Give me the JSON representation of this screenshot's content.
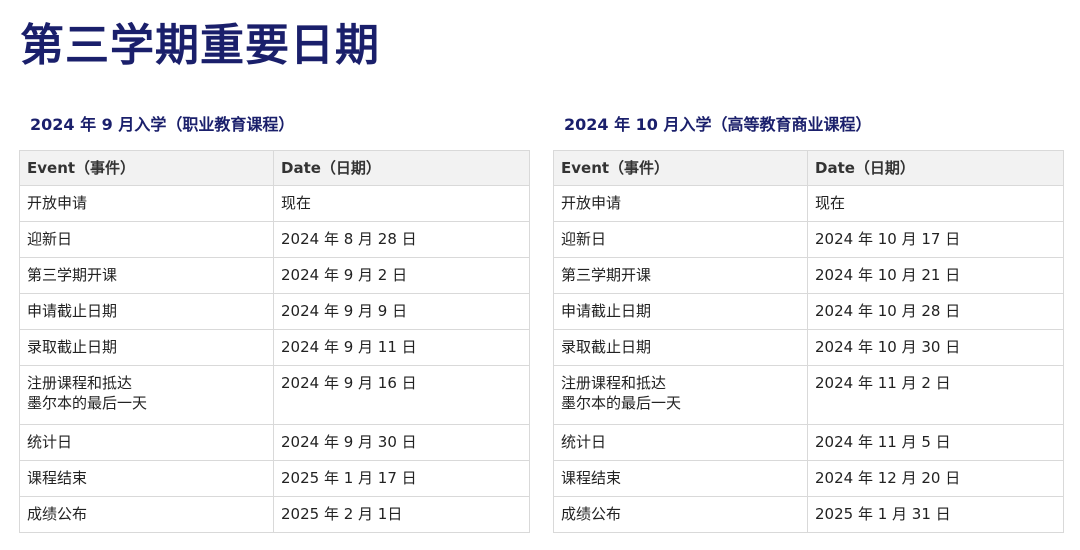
{
  "page": {
    "title": "第三学期重要日期"
  },
  "sections": [
    {
      "heading": "2024 年 9 月入学（职业教育课程）",
      "columns": [
        "Event（事件）",
        "Date（日期）"
      ],
      "rows": [
        {
          "event": "开放申请",
          "date": "现在"
        },
        {
          "event": "迎新日",
          "date": "2024 年 8 月 28 日"
        },
        {
          "event": "第三学期开课",
          "date": "2024 年 9 月 2 日"
        },
        {
          "event": "申请截止日期",
          "date": "2024 年 9 月 9 日"
        },
        {
          "event": "录取截止日期",
          "date": "2024 年 9 月 11 日"
        },
        {
          "event": "注册课程和抵达\n墨尔本的最后一天",
          "date": "2024 年 9 月 16 日"
        },
        {
          "event": "统计日",
          "date": "2024 年 9 月 30 日"
        },
        {
          "event": "课程结束",
          "date": "2025 年 1 月 17 日"
        },
        {
          "event": "成绩公布",
          "date": "2025 年 2 月 1日"
        }
      ]
    },
    {
      "heading": "2024 年 10 月入学（高等教育商业课程）",
      "columns": [
        "Event（事件）",
        "Date（日期）"
      ],
      "rows": [
        {
          "event": "开放申请",
          "date": "现在"
        },
        {
          "event": "迎新日",
          "date": "2024 年 10 月 17 日"
        },
        {
          "event": "第三学期开课",
          "date": "2024 年 10 月 21 日"
        },
        {
          "event": "申请截止日期",
          "date": "2024 年 10 月 28 日"
        },
        {
          "event": "录取截止日期",
          "date": "2024 年 10 月 30 日"
        },
        {
          "event": "注册课程和抵达\n墨尔本的最后一天",
          "date": "2024 年 11 月 2 日"
        },
        {
          "event": "统计日",
          "date": "2024 年 11 月 5 日"
        },
        {
          "event": "课程结束",
          "date": "2024 年 12 月 20 日"
        },
        {
          "event": "成绩公布",
          "date": "2025 年 1 月 31 日"
        }
      ]
    }
  ]
}
